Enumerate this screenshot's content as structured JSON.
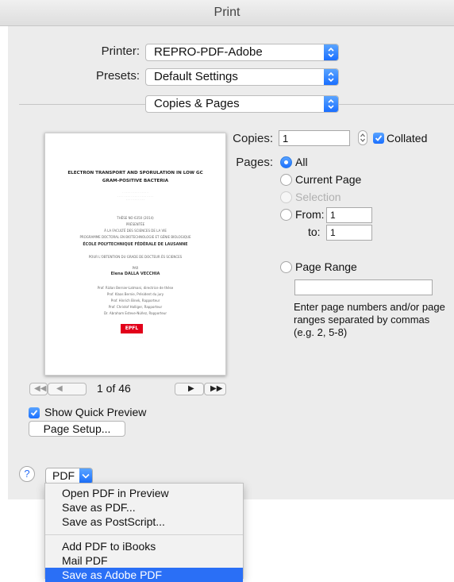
{
  "window": {
    "title": "Print"
  },
  "printer": {
    "label": "Printer:",
    "value": "REPRO-PDF-Adobe"
  },
  "presets": {
    "label": "Presets:",
    "value": "Default Settings"
  },
  "section": {
    "value": "Copies & Pages"
  },
  "preview": {
    "doc_title_line1": "ELECTRON TRANSPORT AND SPORULATION IN LOW GC",
    "doc_title_line2": "GRAM-POSITIVE BACTERIA",
    "doc_lines_a": [
      "THÈSE NO 6350 (2014)",
      "PRÉSENTÉE",
      "À LA FACULTÉ DES SCIENCES DE LA VIE",
      "PROGRAMME DOCTORAL EN BIOTECHNOLOGIE ET GÉNIE BIOLOGIQUE"
    ],
    "doc_school": "ÉCOLE POLYTECHNIQUE FÉDÉRALE DE LAUSANNE",
    "doc_grade": "POUR L'OBTENTION DU GRADE DE DOCTEUR ÈS SCIENCES",
    "doc_par": "PAR",
    "doc_author": "Elena DALLA VECCHIA",
    "doc_jury": [
      "Prof. Rizlan Bernier-Latmani, directrice de thèse",
      "Prof. Klaas Bernie, Président du jury",
      "Prof. Hinrich Binek, Rapporteur",
      "Prof. Christof Holliger, Rapporteur",
      "Dr. Abraham Esteve-Núñez, Rapporteur"
    ],
    "logo_text": "EPFL",
    "logo_color": "#e2001a"
  },
  "pager": {
    "text": "1 of 46"
  },
  "quick_preview": {
    "label": "Show Quick Preview",
    "checked": true
  },
  "page_setup": {
    "label": "Page Setup..."
  },
  "copies": {
    "label": "Copies:",
    "value": "1",
    "collated_label": "Collated",
    "collated": true
  },
  "pages": {
    "label": "Pages:",
    "all": "All",
    "current": "Current Page",
    "selection": "Selection",
    "from_label": "From:",
    "from_value": "1",
    "to_label": "to:",
    "to_value": "1",
    "range_label": "Page Range",
    "range_value": "",
    "hint": [
      "Enter page numbers and/or page",
      "ranges separated by commas",
      "(e.g. 2, 5-8)"
    ]
  },
  "help": {
    "label": "?"
  },
  "pdf": {
    "label": "PDF"
  },
  "pdf_menu": {
    "items": [
      "Open PDF in Preview",
      "Save as PDF...",
      "Save as PostScript...",
      "Add PDF to iBooks",
      "Mail PDF",
      "Save as Adobe PDF"
    ]
  },
  "colors": {
    "accent": "#1a6fff",
    "highlight": "#2a6ff6"
  }
}
